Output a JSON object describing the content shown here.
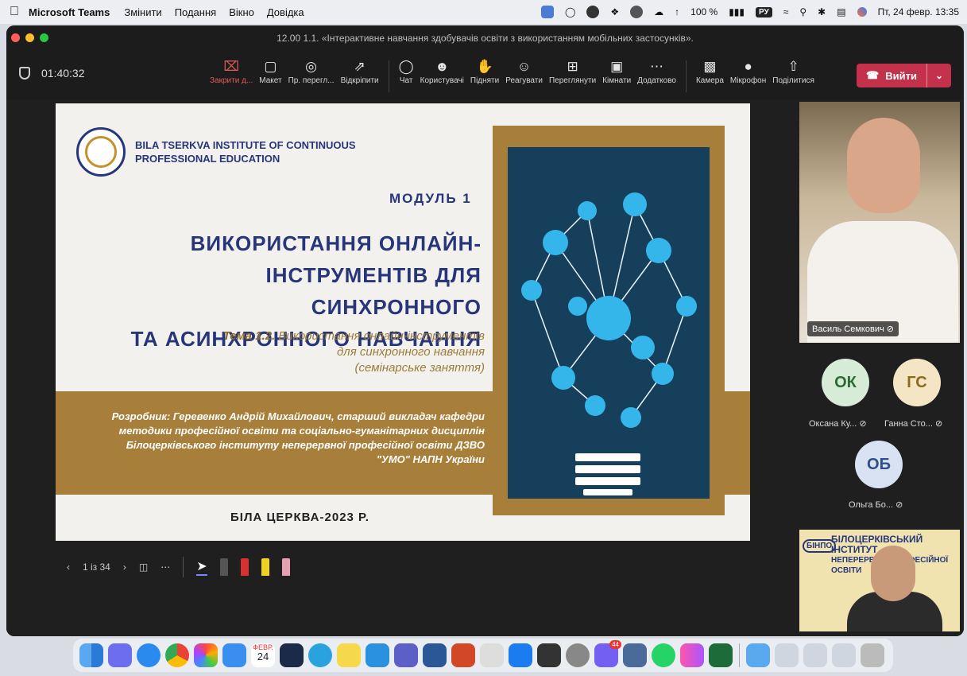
{
  "menubar": {
    "app_name": "Microsoft Teams",
    "items": [
      "Змінити",
      "Подання",
      "Вікно",
      "Довідка"
    ],
    "battery": "100 %",
    "input_source": "РУ",
    "datetime": "Пт, 24 февр. 13:35"
  },
  "window": {
    "title": "12.00 1.1. «Інтерактивне навчання здобувачів освіти з використанням мобільних застосунків»."
  },
  "toolbar": {
    "timer": "01:40:32",
    "tools": [
      {
        "label": "Закрити д...",
        "icon": "close-box-icon"
      },
      {
        "label": "Макет",
        "icon": "layout-icon"
      },
      {
        "label": "Пр. перегл...",
        "icon": "presenter-view-icon"
      },
      {
        "label": "Відкріпити",
        "icon": "pop-out-icon"
      }
    ],
    "tools2": [
      {
        "label": "Чат",
        "icon": "chat-icon"
      },
      {
        "label": "Користувачі",
        "icon": "people-icon"
      },
      {
        "label": "Підняти",
        "icon": "raise-hand-icon"
      },
      {
        "label": "Реагувати",
        "icon": "react-icon"
      },
      {
        "label": "Переглянути",
        "icon": "view-icon"
      },
      {
        "label": "Кімнати",
        "icon": "rooms-icon"
      },
      {
        "label": "Додатково",
        "icon": "more-icon"
      }
    ],
    "tools3": [
      {
        "label": "Камера",
        "icon": "camera-icon"
      },
      {
        "label": "Мікрофон",
        "icon": "microphone-icon"
      },
      {
        "label": "Поділитися",
        "icon": "share-icon"
      }
    ],
    "leave_label": "Вийти"
  },
  "slide": {
    "institute": "BILA TSERKVA INSTITUTE OF CONTINUOUS PROFESSIONAL EDUCATION",
    "module": "МОДУЛЬ 1",
    "title_lines": [
      "ВИКОРИСТАННЯ ОНЛАЙН-",
      "ІНСТРУМЕНТІВ ДЛЯ СИНХРОННОГО",
      "ТА АСИНХРОННОГО НАВЧАННЯ"
    ],
    "topic_bold": "Тема 1.2.",
    "topic_lines": [
      "Використання онлайн-інструментів",
      "для синхронного навчання",
      "(семінарське заняття)"
    ],
    "author_lines": [
      "Розробник: Геревенко Андрій Михайлович, старший викладач кафедри",
      "методики професійної освіти та соціально-гуманітарних дисциплін",
      "Білоцерківського інституту неперервної професійної освіти ДЗВО",
      "\"УМО\" НАПН України"
    ],
    "city": "БІЛА ЦЕРКВА-2023 Р."
  },
  "slide_controls": {
    "page": "1 із 34"
  },
  "participants": {
    "main_speaker": "Василь Семкович",
    "others": [
      {
        "initials": "ОК",
        "name": "Оксана Ку...",
        "bg": "#d7ecd6",
        "fg": "#2c6b34"
      },
      {
        "initials": "ГС",
        "name": "Ганна Сто...",
        "bg": "#f4e6c4",
        "fg": "#8a6a1c"
      },
      {
        "initials": "ОБ",
        "name": "Ольга Бо...",
        "bg": "#d9e2f3",
        "fg": "#2f4f85"
      }
    ],
    "small_video_text": [
      "БІЛОЦЕРКІВСЬКИЙ ІНСТИТУТ",
      "НЕПЕРЕРВНОЇ ПРОФЕСІЙНОЇ ОСВІТИ"
    ],
    "small_video_logo": "БІНПО"
  },
  "dock": {
    "calendar_month": "ФЕВР.",
    "calendar_day": "24",
    "badge": "44"
  },
  "colors": {
    "accent_red": "#c4314b",
    "slide_navy": "#27367a",
    "slide_gold": "#a87f3a"
  }
}
